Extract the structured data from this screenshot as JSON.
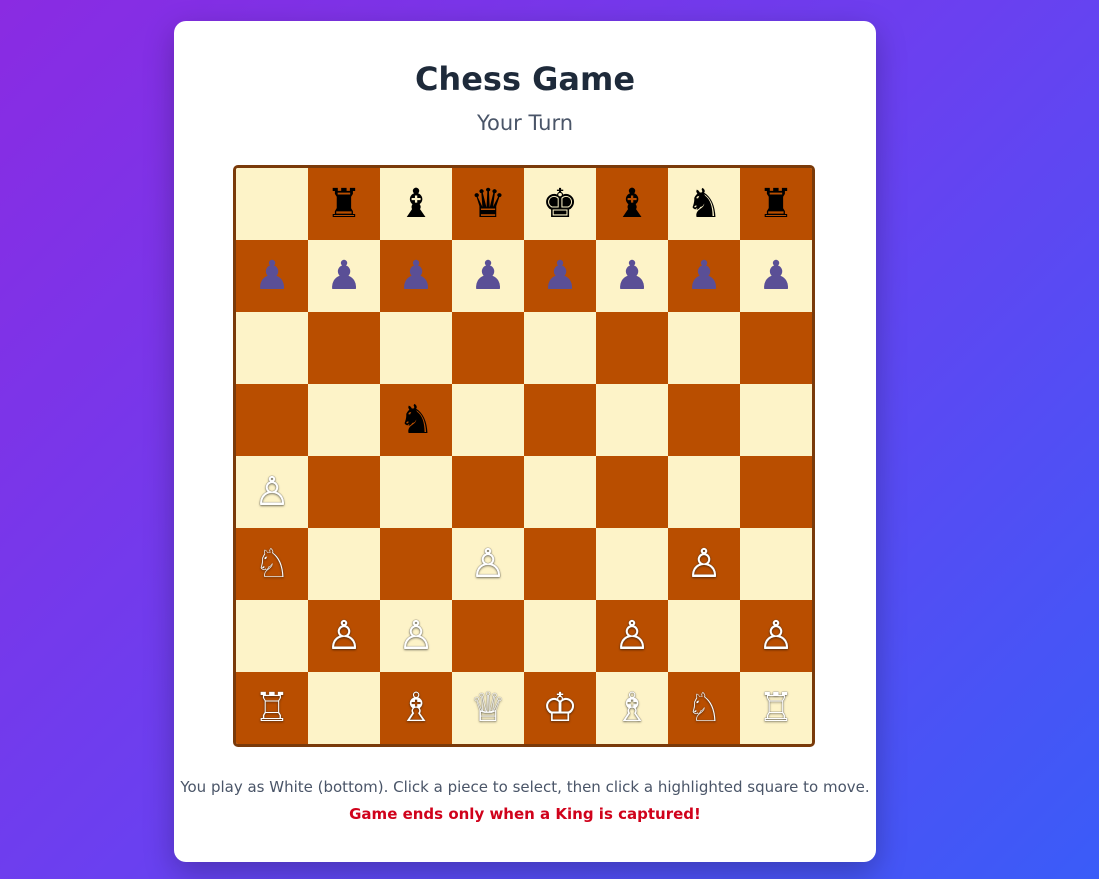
{
  "title": "Chess Game",
  "status": "Your Turn",
  "instructions": "You play as White (bottom). Click a piece to select, then click a highlighted square to move.",
  "warning": "Game ends only when a King is captured!",
  "colors": {
    "light_square": "#fdf3c8",
    "dark_square": "#b94e00",
    "warning": "#d0021b"
  },
  "board": [
    [
      "",
      "bR",
      "bB",
      "bQ",
      "bK",
      "bB",
      "bN",
      "bR"
    ],
    [
      "bP",
      "bP",
      "bP",
      "bP",
      "bP",
      "bP",
      "bP",
      "bP"
    ],
    [
      "",
      "",
      "",
      "",
      "",
      "",
      "",
      ""
    ],
    [
      "",
      "",
      "bN",
      "",
      "",
      "",
      "",
      ""
    ],
    [
      "wP",
      "",
      "",
      "",
      "",
      "",
      "",
      ""
    ],
    [
      "wN",
      "",
      "",
      "wP",
      "",
      "",
      "wP",
      ""
    ],
    [
      "",
      "wP",
      "wP",
      "",
      "",
      "wP",
      "",
      "wP"
    ],
    [
      "wR",
      "",
      "wB",
      "wQ",
      "wK",
      "wB",
      "wN",
      "wR"
    ]
  ]
}
